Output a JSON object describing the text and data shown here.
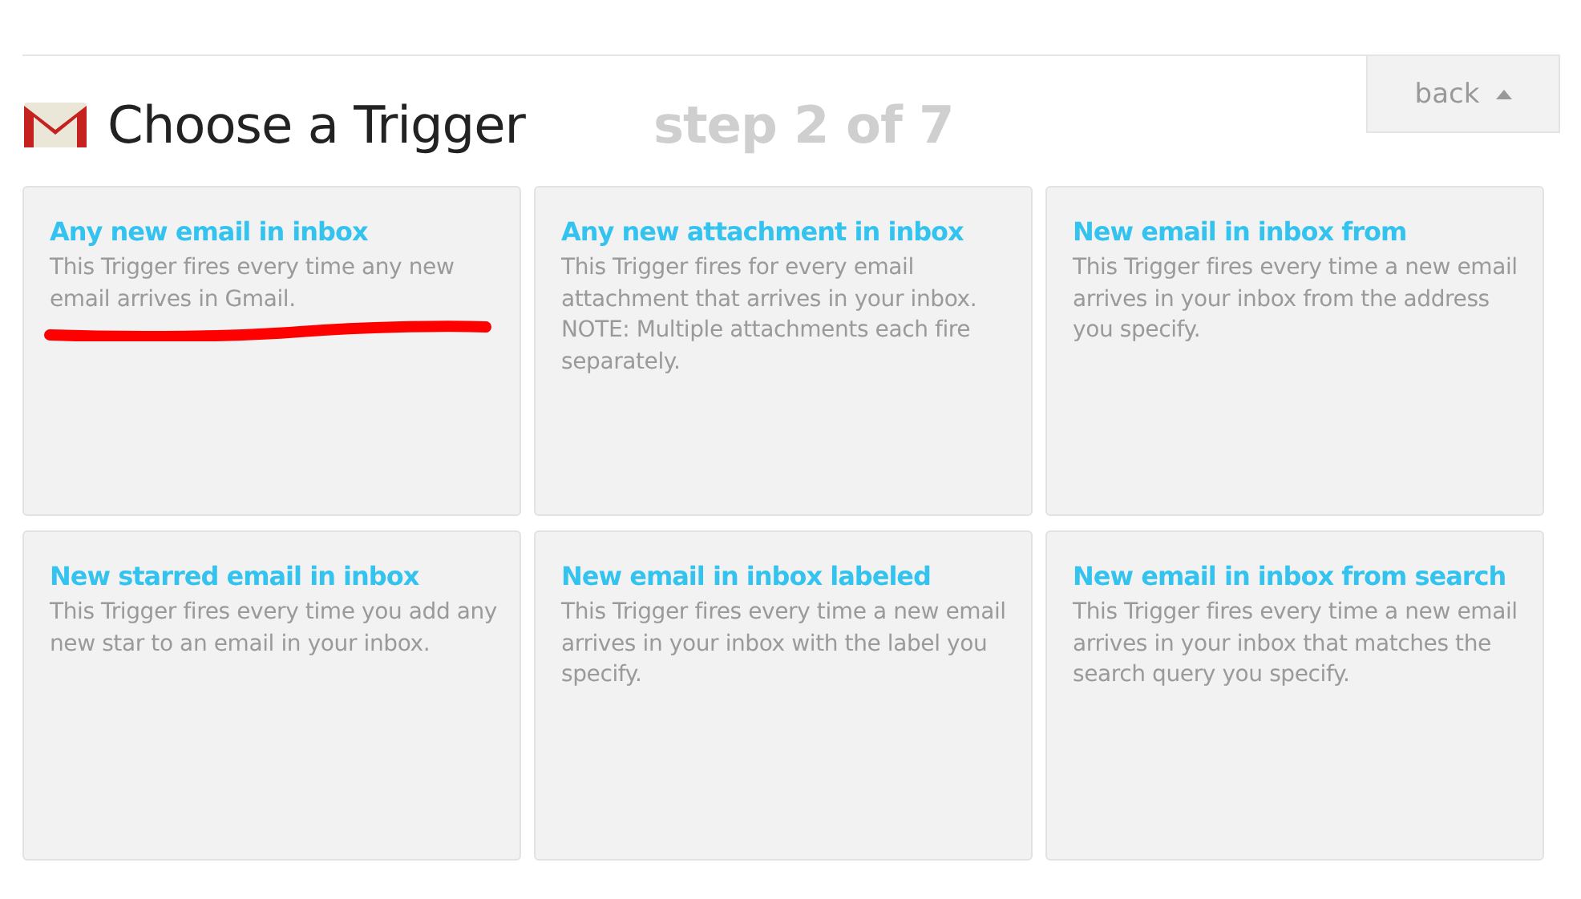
{
  "header": {
    "title": "Choose a Trigger",
    "step": "step 2 of 7",
    "back_button": "back"
  },
  "triggers": [
    {
      "title": "Any new email in inbox",
      "description": "This Trigger fires every time any new email arrives in Gmail.",
      "underlined": true
    },
    {
      "title": "Any new attachment in inbox",
      "description": "This Trigger fires for every email attachment that arrives in your inbox. NOTE: Multiple attachments each fire separately.",
      "underlined": false
    },
    {
      "title": "New email in inbox from",
      "description": "This Trigger fires every time a new email arrives in your inbox from the address you specify.",
      "underlined": false
    },
    {
      "title": "New starred email in inbox",
      "description": "This Trigger fires every time you add any new star to an email in your inbox.",
      "underlined": false
    },
    {
      "title": "New email in inbox labeled",
      "description": "This Trigger fires every time a new email arrives in your inbox with the label you specify.",
      "underlined": false
    },
    {
      "title": "New email in inbox from search",
      "description": "This Trigger fires every time a new email arrives in your inbox that matches the search query you specify.",
      "underlined": false
    }
  ]
}
